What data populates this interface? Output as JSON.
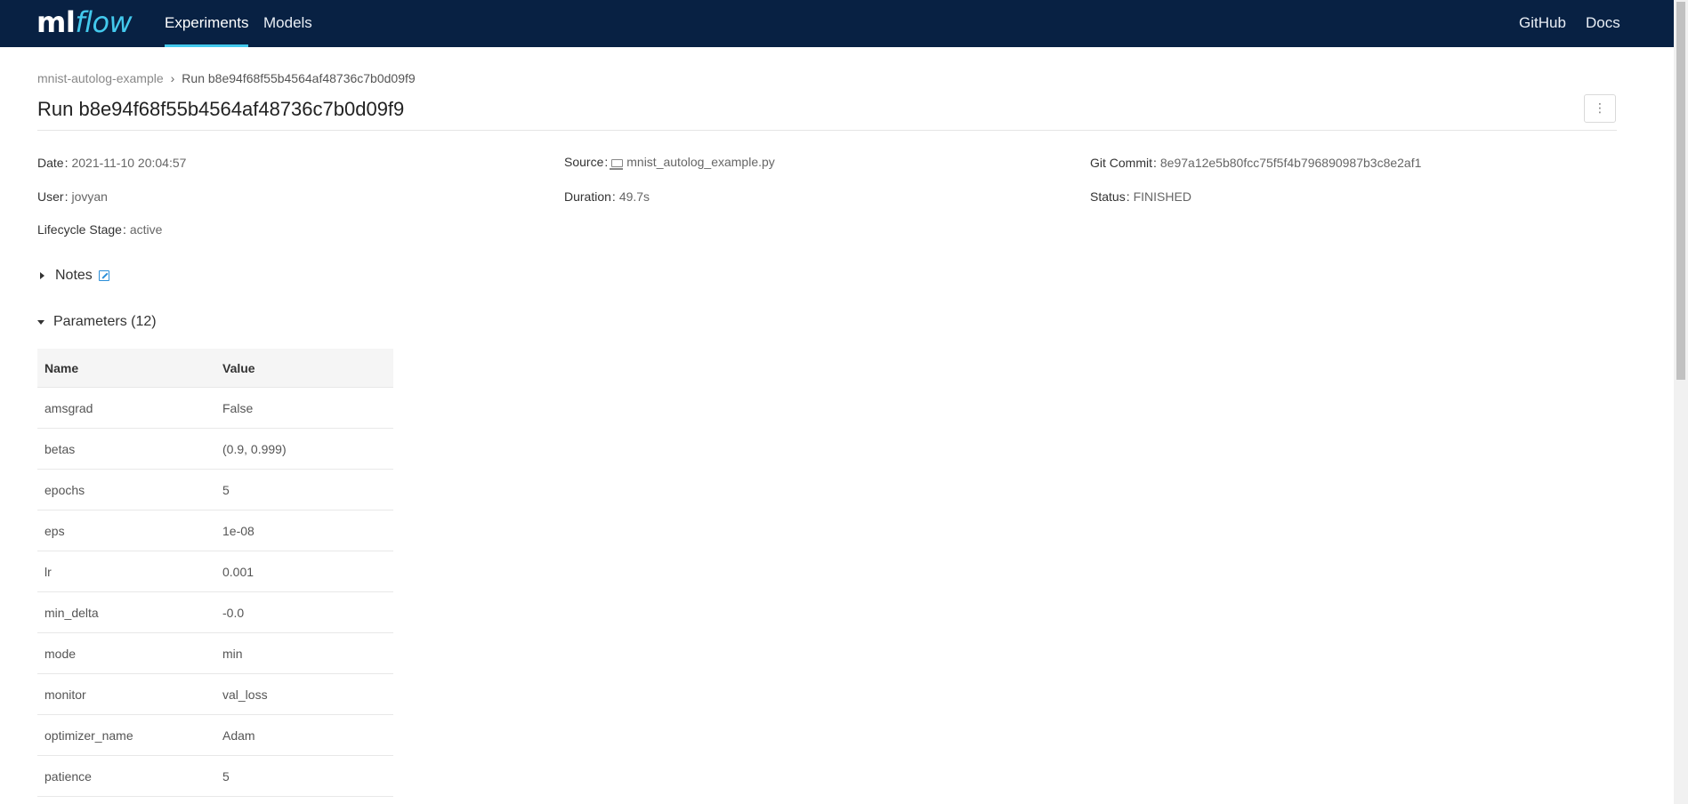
{
  "header": {
    "logo_ml": "ml",
    "logo_flow": "flow",
    "nav": [
      {
        "label": "Experiments",
        "active": true
      },
      {
        "label": "Models",
        "active": false
      }
    ],
    "right_links": [
      "GitHub",
      "Docs"
    ]
  },
  "breadcrumb": {
    "experiment": "mnist-autolog-example",
    "current": "Run b8e94f68f55b4564af48736c7b0d09f9"
  },
  "page_title": "Run b8e94f68f55b4564af48736c7b0d09f9",
  "menu_button": "⋮",
  "meta": {
    "date_label": "Date",
    "date_value": "2021-11-10 20:04:57",
    "source_label": "Source",
    "source_value": "mnist_autolog_example.py",
    "git_label": "Git Commit",
    "git_value": "8e97a12e5b80fcc75f5f4b796890987b3c8e2af1",
    "user_label": "User",
    "user_value": "jovyan",
    "duration_label": "Duration",
    "duration_value": "49.7s",
    "status_label": "Status",
    "status_value": "FINISHED",
    "lifecycle_label": "Lifecycle Stage",
    "lifecycle_value": "active"
  },
  "notes": {
    "label": "Notes"
  },
  "parameters": {
    "label": "Parameters (12)",
    "columns": [
      "Name",
      "Value"
    ],
    "rows": [
      {
        "name": "amsgrad",
        "value": "False"
      },
      {
        "name": "betas",
        "value": "(0.9, 0.999)"
      },
      {
        "name": "epochs",
        "value": "5"
      },
      {
        "name": "eps",
        "value": "1e-08"
      },
      {
        "name": "lr",
        "value": "0.001"
      },
      {
        "name": "min_delta",
        "value": "-0.0"
      },
      {
        "name": "mode",
        "value": "min"
      },
      {
        "name": "monitor",
        "value": "val_loss"
      },
      {
        "name": "optimizer_name",
        "value": "Adam"
      },
      {
        "name": "patience",
        "value": "5"
      }
    ]
  },
  "colors": {
    "header_bg": "#082143",
    "accent": "#43c9ed",
    "link": "#2b8ed8"
  }
}
